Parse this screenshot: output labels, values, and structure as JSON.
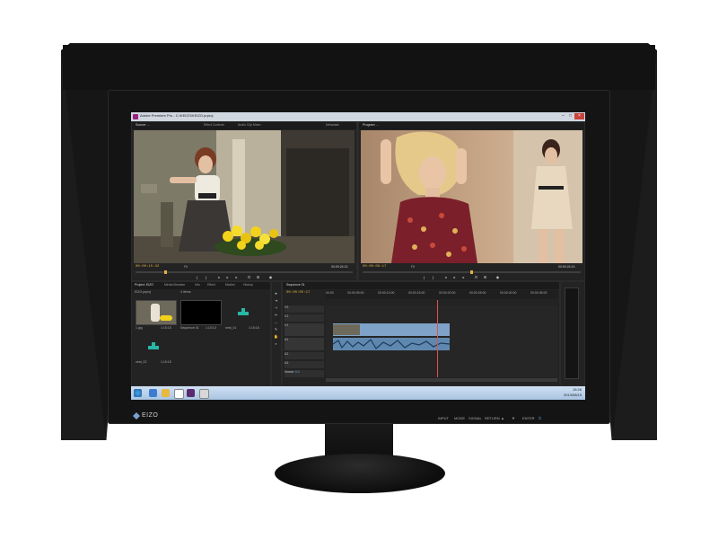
{
  "colors": {
    "hood": "#141414",
    "bezel": "#141414",
    "ui_bg": "#2b2b2b",
    "timecode": "#e0b040",
    "playhead": "#e05050",
    "taskbar": "#bcd2ea"
  },
  "window": {
    "title": "Adobe Premiere Pro - C:\\KEIZO\\KEIZO.prproj"
  },
  "source_panel": {
    "tabs": [
      "Source: ...",
      "Effect Controls",
      "Audio Clip Mixer:",
      "Metadata"
    ],
    "timecode": "00:00:15:32",
    "fit": "Fit",
    "duration": "00:00:24:13"
  },
  "program_panel": {
    "tabs": [
      "Program: ..."
    ],
    "timecode": "00:00:09:17",
    "fit": "Fit",
    "duration": "00:00:24:13"
  },
  "project_panel": {
    "tabs": [
      "Project: EIZO",
      "Media Browser",
      "Info",
      "Effect",
      "Marker",
      "History"
    ],
    "project_name": "EIZO.prproj",
    "item_count": "4 Items",
    "items": [
      {
        "name": "1.jpg",
        "duration": "1:15:18",
        "thumb": "image"
      },
      {
        "name": "Sequence 01",
        "duration": "1:10:13",
        "thumb": "black"
      },
      {
        "name": "nest_01",
        "duration": "1:15:18",
        "thumb": "icon"
      },
      {
        "name": "nest_02",
        "duration": "1:15:18",
        "thumb": "icon"
      }
    ]
  },
  "timeline_panel": {
    "tab": "Sequence 01",
    "timecode": "00:00:05:17",
    "ruler": [
      "00:00",
      "00:00:05:00",
      "00:00:10:00",
      "00:00:15:00",
      "00:00:20:00",
      "00:00:25:00",
      "00:00:30:00",
      "00:00:35:00"
    ],
    "tracks": [
      "V3",
      "V2",
      "V1",
      "A1",
      "A2",
      "A3",
      "Master"
    ],
    "master_value": "0.0"
  },
  "taskbar": {
    "clock_time": "15:26",
    "clock_date": "2013/08/15"
  },
  "monitor": {
    "brand": "EIZO",
    "buttons": [
      "INPUT",
      "MODE",
      "SIGNAL",
      "RETURN",
      "▲",
      "▼",
      "ENTER",
      "⏻"
    ]
  }
}
